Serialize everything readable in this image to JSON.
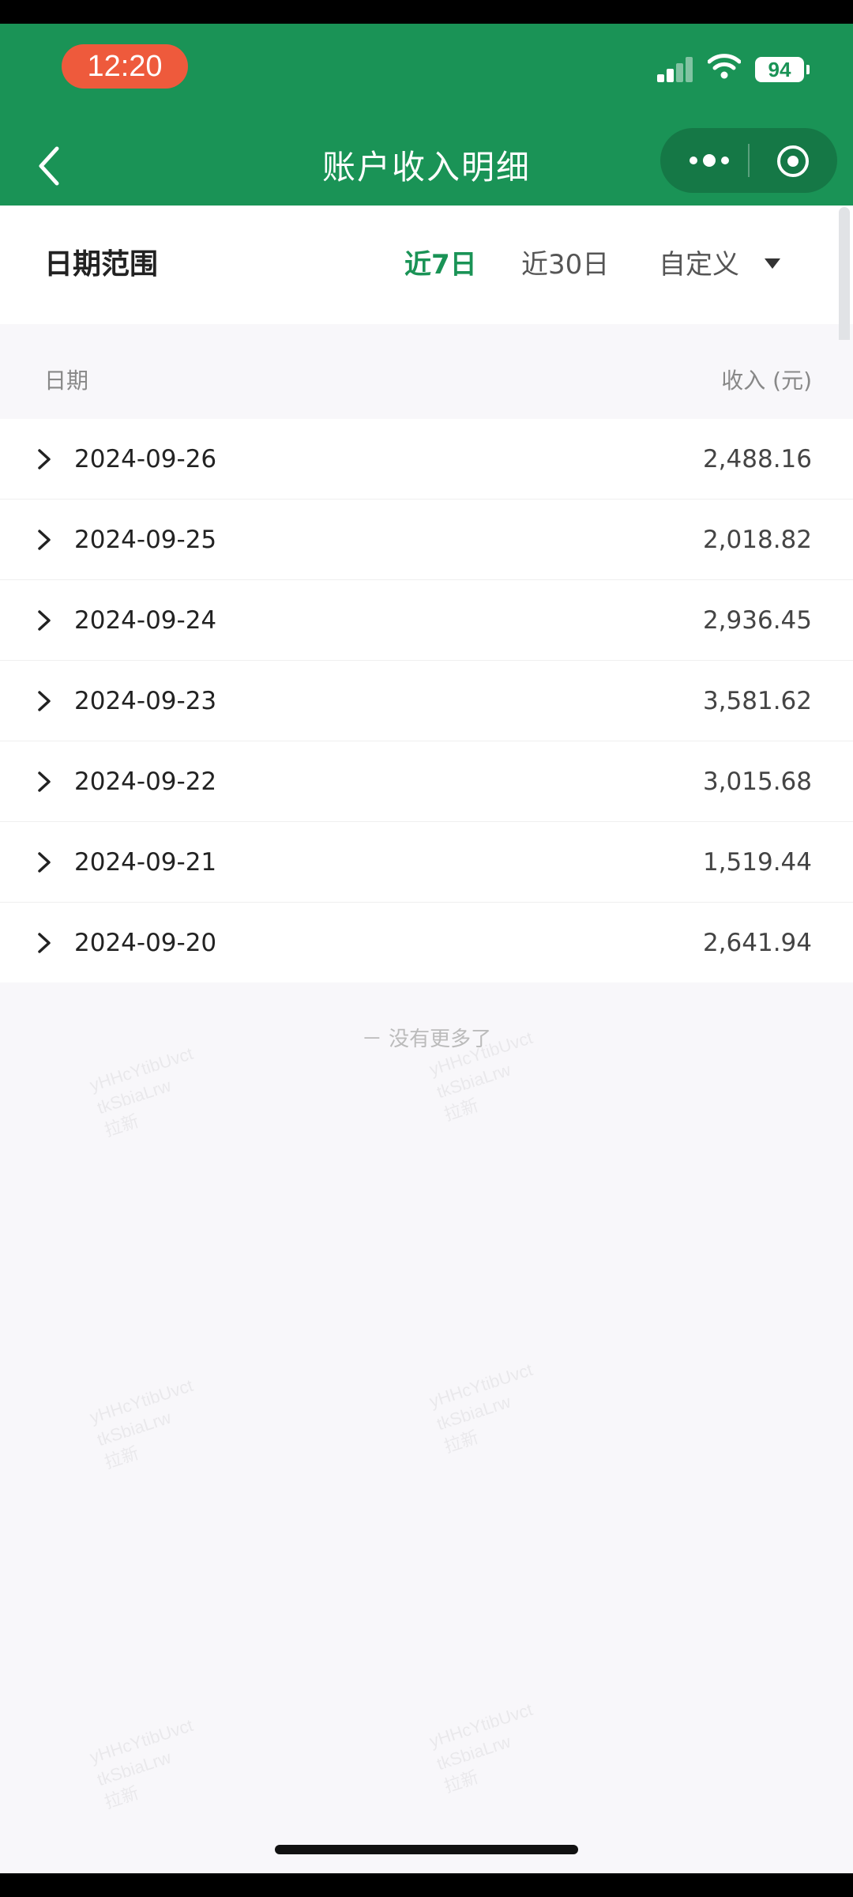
{
  "status_bar": {
    "time": "12:20",
    "battery": "94"
  },
  "nav": {
    "title": "账户收入明细"
  },
  "filter": {
    "label": "日期范围",
    "options": [
      "近7日",
      "近30日",
      "自定义"
    ],
    "active_index": 0
  },
  "table": {
    "header_date": "日期",
    "header_amount": "收入 (元)",
    "rows": [
      {
        "date": "2024-09-26",
        "amount": "2,488.16"
      },
      {
        "date": "2024-09-25",
        "amount": "2,018.82"
      },
      {
        "date": "2024-09-24",
        "amount": "2,936.45"
      },
      {
        "date": "2024-09-23",
        "amount": "3,581.62"
      },
      {
        "date": "2024-09-22",
        "amount": "3,015.68"
      },
      {
        "date": "2024-09-21",
        "amount": "1,519.44"
      },
      {
        "date": "2024-09-20",
        "amount": "2,641.94"
      }
    ]
  },
  "footer": {
    "no_more": "－ 没有更多了"
  },
  "colors": {
    "brand_green": "#1a9356",
    "time_pill": "#ee5a3c"
  },
  "icons": [
    "back-arrow-icon",
    "more-dots-icon",
    "target-icon",
    "chevron-right-icon",
    "caret-down-icon",
    "signal-icon",
    "wifi-icon"
  ]
}
